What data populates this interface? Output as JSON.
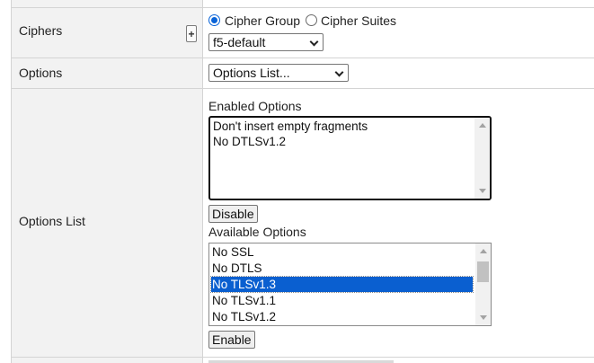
{
  "rows": {
    "ciphers": {
      "label": "Ciphers",
      "add_label": "+",
      "radio_group": {
        "options": [
          {
            "label": "Cipher Group",
            "checked": true
          },
          {
            "label": "Cipher Suites",
            "checked": false
          }
        ]
      },
      "select_value": "f5-default"
    },
    "options": {
      "label": "Options",
      "select_value": "Options List..."
    },
    "options_list": {
      "label": "Options List",
      "enabled": {
        "heading": "Enabled Options",
        "items": [
          "Don't insert empty fragments",
          "No DTLSv1.2"
        ],
        "button_label": "Disable"
      },
      "available": {
        "heading": "Available Options",
        "items": [
          "No SSL",
          "No DTLS",
          "No TLSv1.3",
          "No TLSv1.1",
          "No TLSv1.2"
        ],
        "selected_index": 2,
        "button_label": "Enable"
      }
    }
  },
  "colors": {
    "label_column_bg": "#f2f2f2",
    "selection_bg": "#0a5fd0",
    "radio_accent": "#0a64d8",
    "border": "#d4d4d4"
  },
  "icons": {
    "dropdown": "chevron-down-icon",
    "scroll_up": "scroll-up-arrow-icon",
    "scroll_down": "scroll-down-arrow-icon"
  }
}
